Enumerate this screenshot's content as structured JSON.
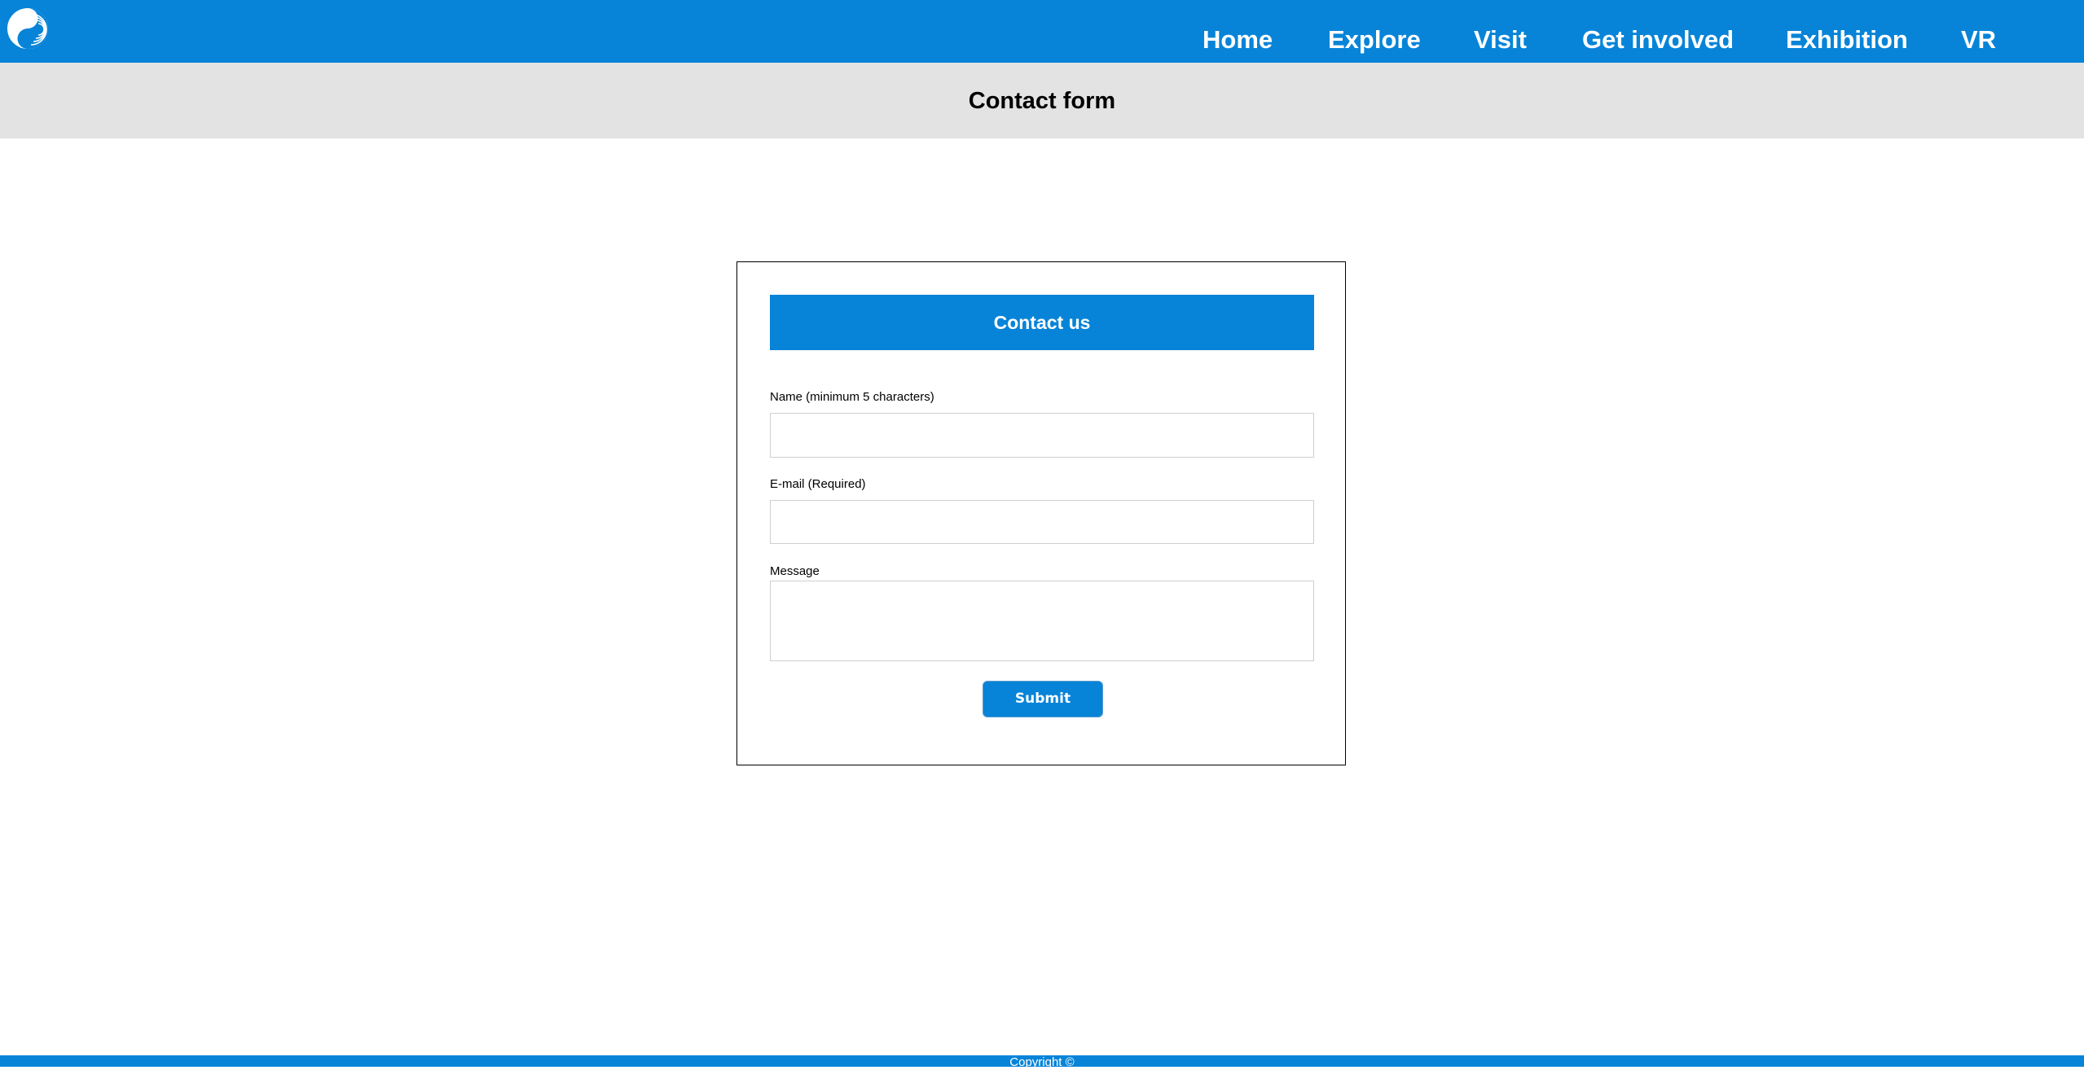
{
  "header": {
    "logo_icon": "swirl-logo-icon",
    "nav": [
      {
        "label": "Home"
      },
      {
        "label": "Explore"
      },
      {
        "label": "Visit"
      },
      {
        "label": "Get involved"
      },
      {
        "label": "Exhibition"
      },
      {
        "label": "VR"
      }
    ]
  },
  "page": {
    "title": "Contact form"
  },
  "form": {
    "heading": "Contact us",
    "name_label": "Name (minimum 5 characters)",
    "name_value": "",
    "email_label": "E-mail (Required)",
    "email_value": "",
    "message_label": "Message",
    "message_value": "",
    "submit_label": "Submit"
  },
  "footer": {
    "copyright": "Copyright ©"
  },
  "colors": {
    "brand_blue": "#0784d8",
    "title_bar_gray": "#e3e3e3"
  }
}
